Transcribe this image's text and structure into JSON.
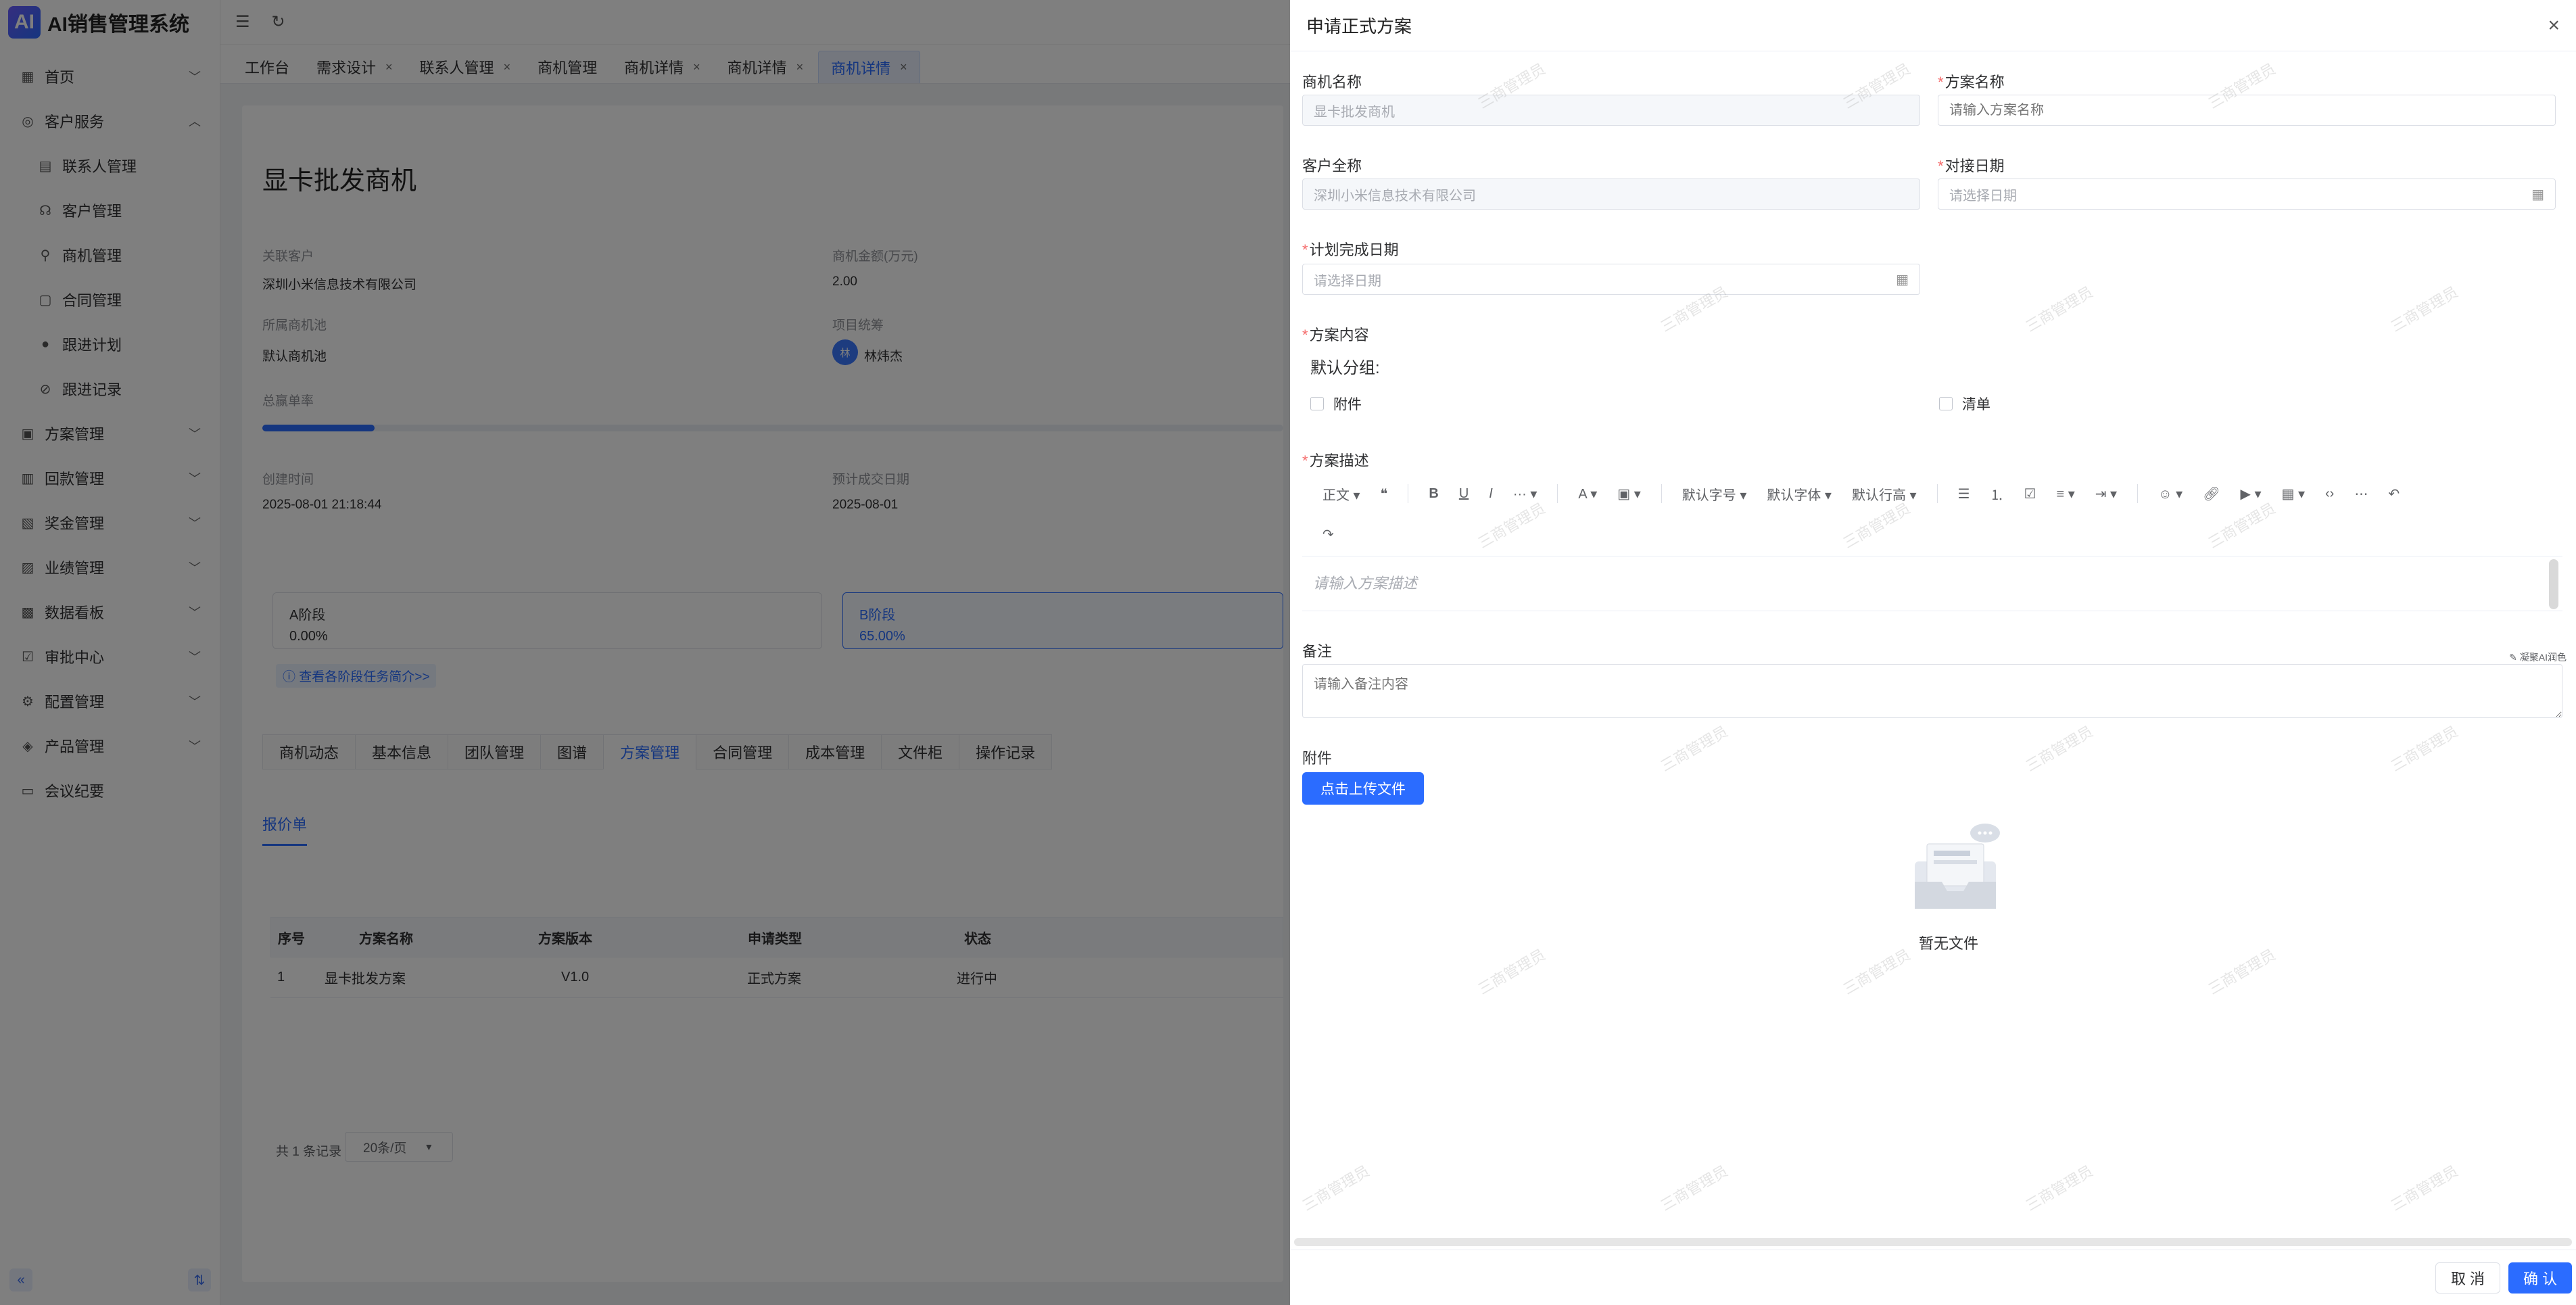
{
  "app": {
    "logo_text": "AI",
    "title": "AI销售管理系统"
  },
  "sidebar": {
    "items": [
      {
        "label": "首页",
        "icon": "dashboard-icon",
        "arrow": "⌄"
      },
      {
        "label": "客户服务",
        "icon": "service-icon",
        "arrow": "⌃"
      },
      {
        "label": "联系人管理",
        "icon": "contact-card-icon",
        "sub": true
      },
      {
        "label": "客户管理",
        "icon": "headset-icon",
        "sub": true
      },
      {
        "label": "商机管理",
        "icon": "user-icon",
        "sub": true
      },
      {
        "label": "合同管理",
        "icon": "document-icon",
        "sub": true
      },
      {
        "label": "跟进计划",
        "icon": "circle-icon",
        "sub": true
      },
      {
        "label": "跟进记录",
        "icon": "compass-icon",
        "sub": true
      },
      {
        "label": "方案管理",
        "icon": "plan-icon",
        "arrow": "⌄"
      },
      {
        "label": "回款管理",
        "icon": "payment-icon",
        "arrow": "⌄"
      },
      {
        "label": "奖金管理",
        "icon": "bonus-icon",
        "arrow": "⌄"
      },
      {
        "label": "业绩管理",
        "icon": "performance-icon",
        "arrow": "⌄"
      },
      {
        "label": "数据看板",
        "icon": "board-icon",
        "arrow": "⌄"
      },
      {
        "label": "审批中心",
        "icon": "approval-icon",
        "arrow": "⌄"
      },
      {
        "label": "配置管理",
        "icon": "gear-icon",
        "arrow": "⌄"
      },
      {
        "label": "产品管理",
        "icon": "product-icon",
        "arrow": "⌄"
      },
      {
        "label": "会议纪要",
        "icon": "meeting-icon"
      }
    ]
  },
  "tabs": [
    {
      "label": "工作台",
      "closable": false
    },
    {
      "label": "需求设计",
      "closable": true
    },
    {
      "label": "联系人管理",
      "closable": true
    },
    {
      "label": "商机管理",
      "closable": false
    },
    {
      "label": "商机详情",
      "closable": true
    },
    {
      "label": "商机详情",
      "closable": true
    },
    {
      "label": "商机详情",
      "closable": true,
      "active": true
    }
  ],
  "detail": {
    "title": "显卡批发商机",
    "related_customer_label": "关联客户",
    "related_customer": "深圳小米信息技术有限公司",
    "amount_label": "商机金额(万元)",
    "amount": "2.00",
    "pool_label": "所属商机池",
    "pool": "默认商机池",
    "coordinator_label": "项目统筹",
    "coordinator_avatar": "林",
    "coordinator": "林炜杰",
    "win_rate_label": "总赢单率",
    "win_rate": 0.11,
    "created_label": "创建时间",
    "created": "2025-08-01 21:18:44",
    "expected_label": "预计成交日期",
    "expected": "2025-08-01",
    "stages": [
      {
        "name": "A阶段",
        "value": "0.00%"
      },
      {
        "name": "B阶段",
        "value": "65.00%"
      }
    ],
    "stage_link": "查看各阶段任务简介>>",
    "detail_tabs": [
      "商机动态",
      "基本信息",
      "团队管理",
      "图谱",
      "方案管理",
      "合同管理",
      "成本管理",
      "文件柜",
      "操作记录"
    ],
    "active_detail_tab": 4,
    "sub_tab": "报价单",
    "table": {
      "headers": [
        "序号",
        "方案名称",
        "方案版本",
        "申请类型",
        "状态"
      ],
      "rows": [
        [
          "1",
          "显卡批发方案",
          "V1.0",
          "正式方案",
          "进行中"
        ]
      ]
    },
    "total": "共 1 条记录",
    "page_size": "20条/页"
  },
  "drawer": {
    "title": "申请正式方案",
    "fields": {
      "opportunity_name_label": "商机名称",
      "opportunity_name_value": "显卡批发商机",
      "plan_name_label": "方案名称",
      "plan_name_placeholder": "请输入方案名称",
      "customer_label": "客户全称",
      "customer_value": "深圳小米信息技术有限公司",
      "dock_date_label": "对接日期",
      "dock_date_placeholder": "请选择日期",
      "plan_done_label": "计划完成日期",
      "plan_done_placeholder": "请选择日期",
      "content_label": "方案内容",
      "group_title": "默认分组:",
      "checkbox_attachment": "附件",
      "checkbox_list": "清单",
      "desc_label": "方案描述",
      "desc_placeholder": "请输入方案描述",
      "remark_label": "备注",
      "remark_placeholder": "请输入备注内容",
      "ai_tip": "✎ 凝聚AI润色",
      "attachment_label": "附件",
      "upload_button": "点击上传文件",
      "empty_text": "暂无文件"
    },
    "toolbar": {
      "paragraph": "正文",
      "font_size": "默认字号",
      "font_family": "默认字体",
      "line_height": "默认行高"
    },
    "cancel": "取 消",
    "ok": "确 认"
  },
  "watermark": "三商管理员"
}
